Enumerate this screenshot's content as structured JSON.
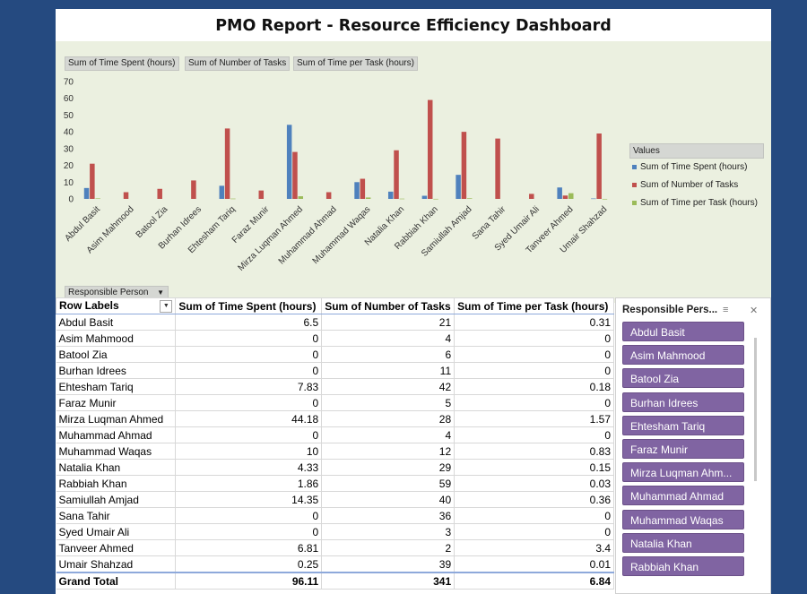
{
  "title": "PMO Report - Resource Efficiency Dashboard",
  "colors": {
    "time_spent": "#4f81bd",
    "tasks": "#c0504d",
    "time_per_task": "#9bbb59",
    "slicer": "#8064a2"
  },
  "chart_buttons": [
    "Sum of Time Spent (hours)",
    "Sum of Number of Tasks",
    "Sum of Time per Task (hours)"
  ],
  "row_field_button": "Responsible Person",
  "chart_data": {
    "type": "bar",
    "categories": [
      "Abdul Basit",
      "Asim Mahmood",
      "Batool Zia",
      "Burhan Idrees",
      "Ehtesham Tariq",
      "Faraz Munir",
      "Mirza Luqman Ahmed",
      "Muhammad Ahmad",
      "Muhammad Waqas",
      "Natalia Khan",
      "Rabbiah Khan",
      "Samiullah Amjad",
      "Sana Tahir",
      "Syed Umair Ali",
      "Tanveer Ahmed",
      "Umair Shahzad"
    ],
    "series": [
      {
        "name": "Sum of Time Spent (hours)",
        "values": [
          6.5,
          0,
          0,
          0,
          7.83,
          0,
          44.18,
          0,
          10,
          4.33,
          1.86,
          14.35,
          0,
          0,
          6.81,
          0.25
        ]
      },
      {
        "name": "Sum of Number of Tasks",
        "values": [
          21,
          4,
          6,
          11,
          42,
          5,
          28,
          4,
          12,
          29,
          59,
          40,
          36,
          3,
          2,
          39
        ]
      },
      {
        "name": "Sum of Time per Task (hours)",
        "values": [
          0.31,
          0,
          0,
          0,
          0.18,
          0,
          1.57,
          0,
          0.83,
          0.15,
          0.03,
          0.36,
          0,
          0,
          3.4,
          0.01
        ]
      }
    ],
    "y_ticks": [
      "0",
      "10",
      "20",
      "30",
      "40",
      "50",
      "60",
      "70"
    ],
    "ylim": [
      0,
      70
    ],
    "legend_title": "Values",
    "legend_position": "right",
    "grid": false
  },
  "table": {
    "headers": [
      "Row Labels",
      "Sum of Time Spent (hours)",
      "Sum of Number of Tasks",
      "Sum of Time per Task (hours)"
    ],
    "rows": [
      [
        "Abdul Basit",
        "6.5",
        "21",
        "0.31"
      ],
      [
        "Asim Mahmood",
        "0",
        "4",
        "0"
      ],
      [
        "Batool Zia",
        "0",
        "6",
        "0"
      ],
      [
        "Burhan Idrees",
        "0",
        "11",
        "0"
      ],
      [
        "Ehtesham Tariq",
        "7.83",
        "42",
        "0.18"
      ],
      [
        "Faraz Munir",
        "0",
        "5",
        "0"
      ],
      [
        "Mirza Luqman Ahmed",
        "44.18",
        "28",
        "1.57"
      ],
      [
        "Muhammad Ahmad",
        "0",
        "4",
        "0"
      ],
      [
        "Muhammad Waqas",
        "10",
        "12",
        "0.83"
      ],
      [
        "Natalia Khan",
        "4.33",
        "29",
        "0.15"
      ],
      [
        "Rabbiah Khan",
        "1.86",
        "59",
        "0.03"
      ],
      [
        "Samiullah Amjad",
        "14.35",
        "40",
        "0.36"
      ],
      [
        "Sana Tahir",
        "0",
        "36",
        "0"
      ],
      [
        "Syed Umair Ali",
        "0",
        "3",
        "0"
      ],
      [
        "Tanveer Ahmed",
        "6.81",
        "2",
        "3.4"
      ],
      [
        "Umair Shahzad",
        "0.25",
        "39",
        "0.01"
      ]
    ],
    "total": [
      "Grand Total",
      "96.11",
      "341",
      "6.84"
    ]
  },
  "slicer": {
    "title": "Responsible Pers...",
    "items": [
      "Abdul Basit",
      "Asim Mahmood",
      "Batool Zia",
      "Burhan Idrees",
      "Ehtesham Tariq",
      "Faraz Munir",
      "Mirza Luqman Ahm...",
      "Muhammad Ahmad",
      "Muhammad Waqas",
      "Natalia Khan",
      "Rabbiah Khan"
    ]
  }
}
